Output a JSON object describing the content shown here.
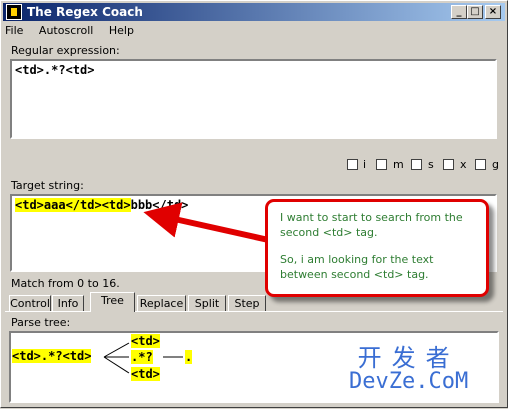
{
  "window": {
    "title": "The Regex Coach"
  },
  "menu": [
    "File",
    "Autoscroll",
    "Help"
  ],
  "regex": {
    "label": "Regular expression:",
    "value": "<td>.*?<td>"
  },
  "flags": [
    {
      "label": "i",
      "checked": false
    },
    {
      "label": "m",
      "checked": false
    },
    {
      "label": "s",
      "checked": false
    },
    {
      "label": "x",
      "checked": false
    },
    {
      "label": "g",
      "checked": false
    }
  ],
  "target": {
    "label": "Target string:",
    "matched": "<td>aaa</td><td>",
    "rest": "bbb</td>"
  },
  "status": "Match from 0 to 16.",
  "tabs": [
    "Control",
    "Info",
    "Tree",
    "Replace",
    "Split",
    "Step"
  ],
  "active_tab": "Tree",
  "parse_tree": {
    "label": "Parse tree:",
    "root": "<td>.*?<td>",
    "children": [
      "<td>",
      ".*?",
      "<td>"
    ],
    "leaf": "."
  },
  "callout": {
    "line1": "I want to start to search from the second <td> tag.",
    "line2": "So, i am looking for the text between second <td> tag.",
    "border_color": "#e00000",
    "text_color": "#2e7d32"
  },
  "watermark": {
    "cn": "开发者",
    "en": "DevZe.CoM"
  }
}
